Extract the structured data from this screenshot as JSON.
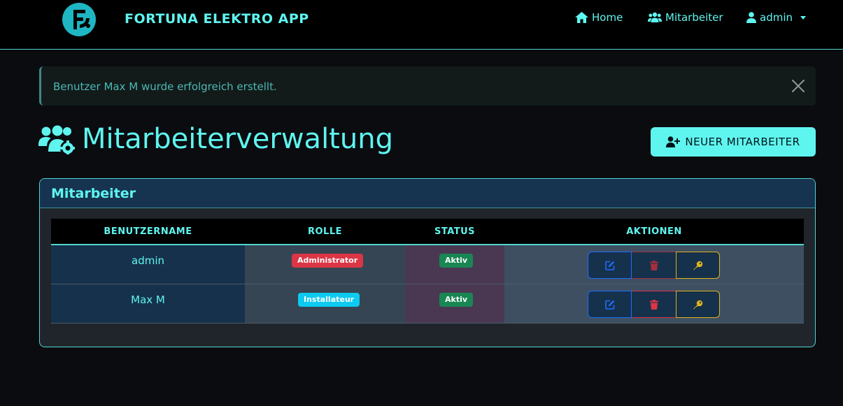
{
  "navbar": {
    "brand": "FORTUNA ELEKTRO APP",
    "links": [
      {
        "label": "Home",
        "icon": "home-icon"
      },
      {
        "label": "Mitarbeiter",
        "icon": "users-icon"
      },
      {
        "label": "admin",
        "icon": "user-icon"
      }
    ]
  },
  "alert": {
    "message": "Benutzer Max M wurde erfolgreich erstellt."
  },
  "page": {
    "title": "Mitarbeiterverwaltung",
    "new_button": "NEUER MITARBEITER"
  },
  "card": {
    "title": "Mitarbeiter",
    "columns": [
      "BENUTZERNAME",
      "ROLLE",
      "STATUS",
      "AKTIONEN"
    ],
    "rows": [
      {
        "username": "admin",
        "role": "Administrator",
        "status": "Aktiv"
      },
      {
        "username": "Max M",
        "role": "Installateur",
        "status": "Aktiv"
      }
    ]
  },
  "colors": {
    "accent": "#5ff5ef",
    "background": "#0b0c10",
    "danger": "#dc3545",
    "info": "#0dcaf0",
    "success": "#198754",
    "primary": "#1d6efd",
    "warning": "#e0b31b"
  }
}
